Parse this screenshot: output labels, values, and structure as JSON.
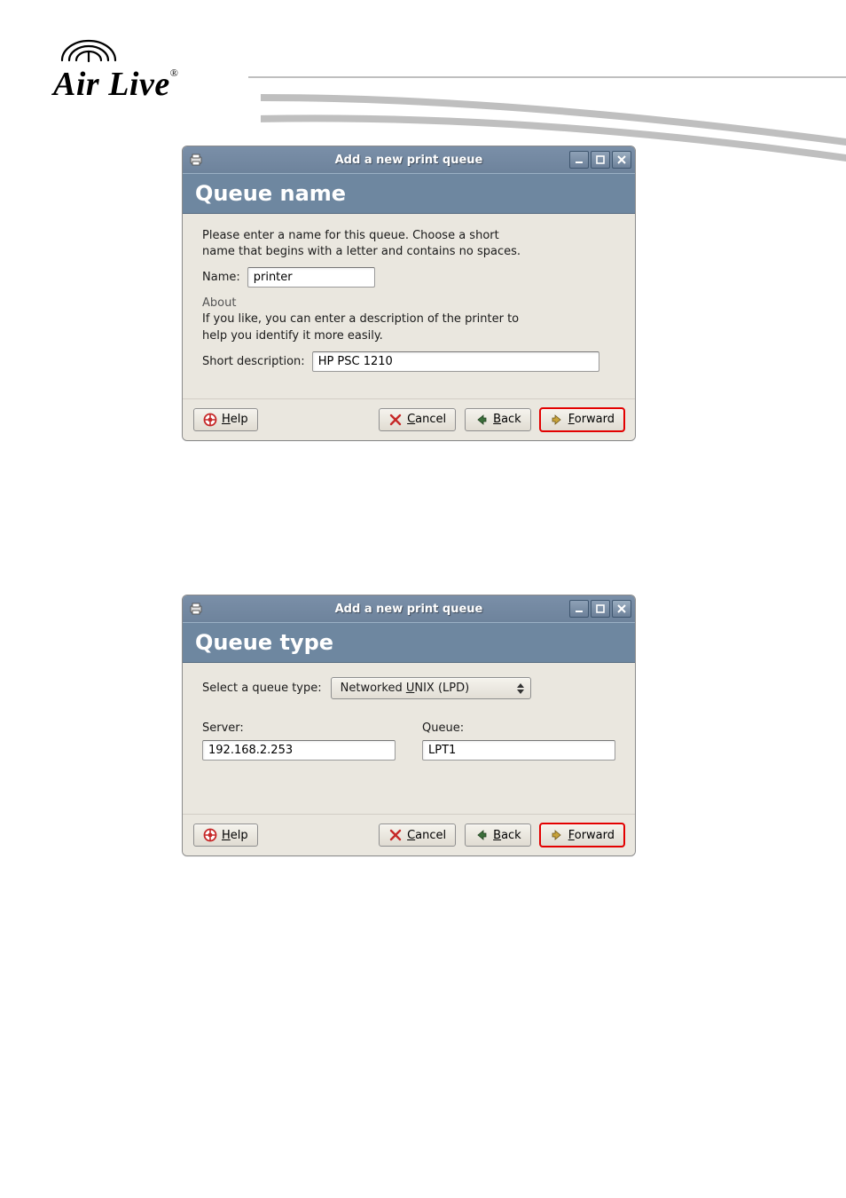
{
  "logo": {
    "text": "Air Live",
    "registered": "®"
  },
  "dialog1": {
    "window_title": "Add a new print queue",
    "section_title": "Queue name",
    "instruction": "Please enter a name for this queue.  Choose a short name that begins with a letter and contains no spaces.",
    "name_label": "Name:",
    "name_value": "printer",
    "about_label": "About",
    "about_text": "If you like, you can enter a description of the printer to help you identify it more easily.",
    "short_desc_label": "Short description:",
    "short_desc_value": "HP PSC 1210",
    "buttons": {
      "help": "Help",
      "cancel": "Cancel",
      "back": "Back",
      "forward": "Forward"
    }
  },
  "dialog2": {
    "window_title": "Add a new print queue",
    "section_title": "Queue type",
    "select_label": "Select a queue type:",
    "select_value_prefix": "Networked ",
    "select_value_underlined": "U",
    "select_value_suffix": "NIX (LPD)",
    "server_label": "Server:",
    "server_value": "192.168.2.253",
    "queue_label": "Queue:",
    "queue_value": "LPT1",
    "buttons": {
      "help": "Help",
      "cancel": "Cancel",
      "back": "Back",
      "forward": "Forward"
    }
  }
}
